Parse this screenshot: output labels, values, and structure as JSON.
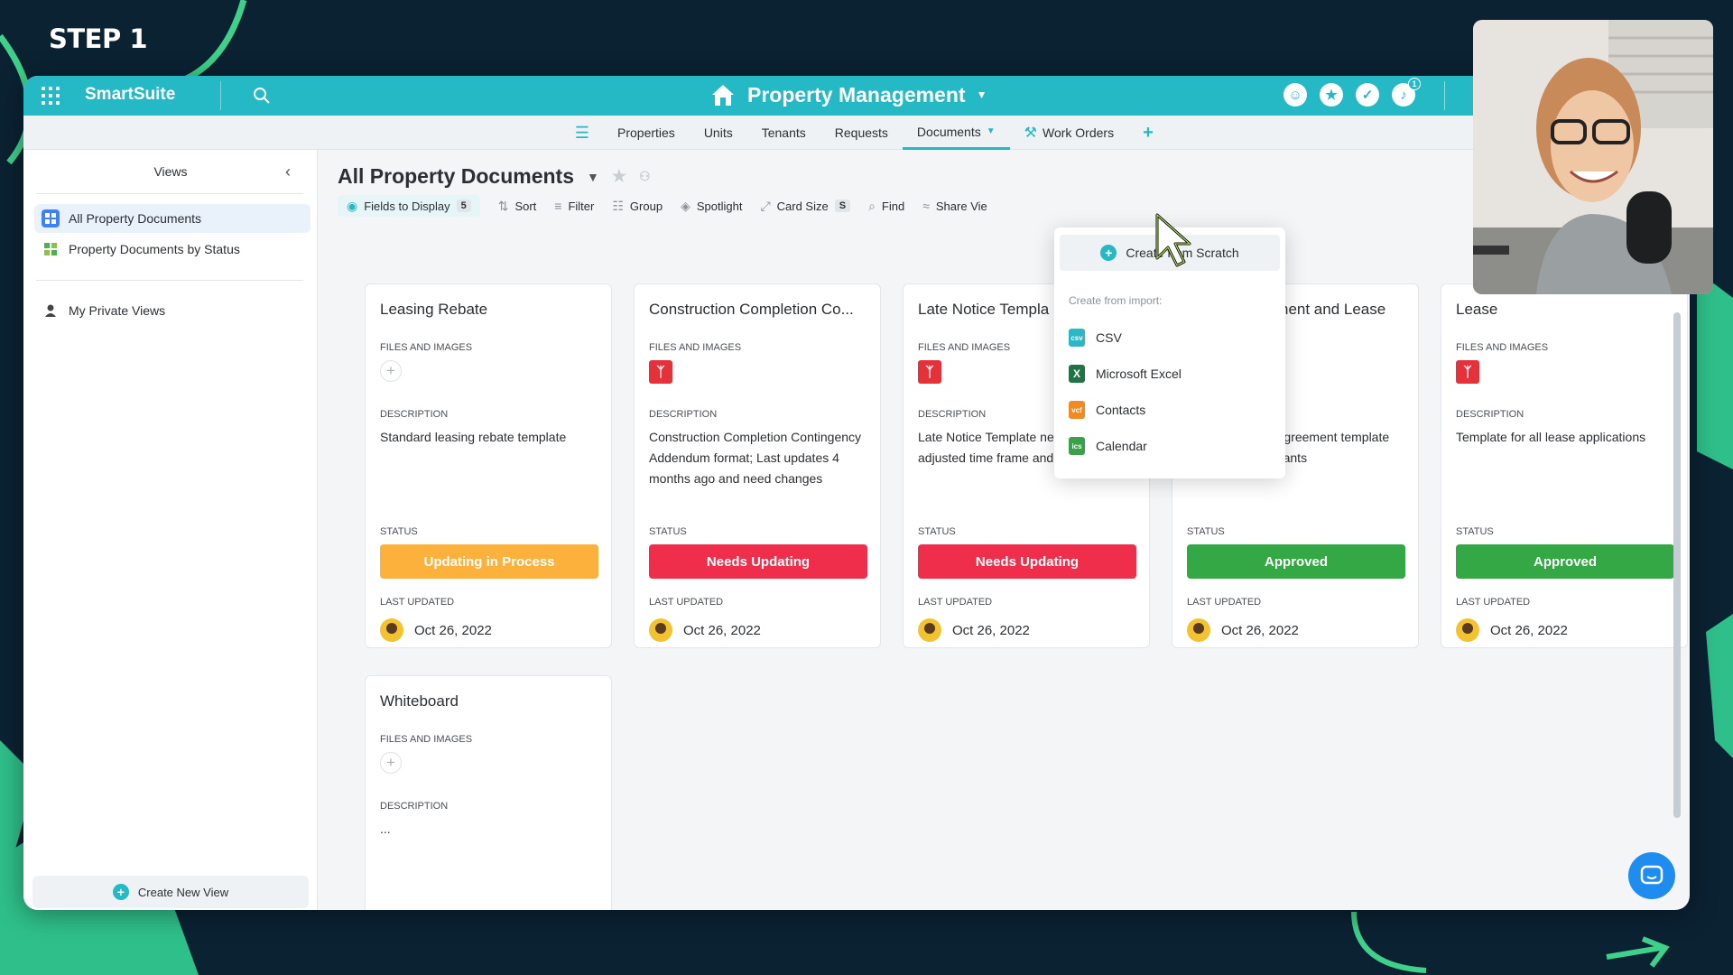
{
  "overlay": {
    "step_label": "STEP 1"
  },
  "app": {
    "brand": "SmartSuite",
    "workspace_title": "Property Management"
  },
  "tabs": [
    {
      "label": "Properties"
    },
    {
      "label": "Units"
    },
    {
      "label": "Tenants"
    },
    {
      "label": "Requests"
    },
    {
      "label": "Documents",
      "active": true
    },
    {
      "label": "Work Orders"
    }
  ],
  "sidebar": {
    "heading": "Views",
    "views": [
      {
        "label": "All Property Documents",
        "selected": true
      },
      {
        "label": "Property Documents by Status"
      }
    ],
    "private_views": "My Private Views",
    "create_view": "Create New View"
  },
  "view": {
    "title": "All Property Documents",
    "toolbar": {
      "fields": "Fields to Display",
      "fields_count": "5",
      "sort": "Sort",
      "filter": "Filter",
      "group": "Group",
      "spotlight": "Spotlight",
      "card_size": "Card Size",
      "card_size_value": "S",
      "find": "Find",
      "share": "Share Vie"
    }
  },
  "labels": {
    "files": "FILES AND IMAGES",
    "description": "DESCRIPTION",
    "status": "STATUS",
    "last_updated": "LAST UPDATED"
  },
  "cards": [
    {
      "title": "Leasing Rebate",
      "has_file": false,
      "description": "Standard leasing rebate template",
      "status": "Updating in Process",
      "status_color": "#fbb13c",
      "updated": "Oct 26, 2022"
    },
    {
      "title": "Construction Completion Co...",
      "has_file": true,
      "description": "Construction Completion Contingency Addendum format; Last updates 4 months ago and need changes",
      "status": "Needs Updating",
      "status_color": "#ee2e4a",
      "updated": "Oct 26, 2022"
    },
    {
      "title": "Late Notice Templa",
      "has_file": true,
      "description": "Late Notice Template needs updating, adjusted time frame and conditions",
      "status": "Needs Updating",
      "status_color": "#ee2e4a",
      "updated": "Oct 26, 2022"
    },
    {
      "title": "Rental Agreement and Lease",
      "has_file": true,
      "description": "Standard rental agreement template for all coming tenants",
      "status": "Approved",
      "status_color": "#33a844",
      "updated": "Oct 26, 2022"
    },
    {
      "title": "Lease",
      "has_file": true,
      "description": "Template for all lease applications",
      "status": "Approved",
      "status_color": "#33a844",
      "updated": "Oct 26, 2022"
    },
    {
      "title": "Whiteboard",
      "has_file": false,
      "description": "...",
      "status": "",
      "status_color": "",
      "updated": ""
    }
  ],
  "dropdown": {
    "create": "Create from Scratch",
    "import_label": "Create from import:",
    "items": [
      {
        "label": "CSV",
        "color": "#2bb8c4",
        "tag": "csv"
      },
      {
        "label": "Microsoft Excel",
        "color": "#217346",
        "tag": "X"
      },
      {
        "label": "Contacts",
        "color": "#f08a24",
        "tag": "vcf"
      },
      {
        "label": "Calendar",
        "color": "#3aa14a",
        "tag": "ics"
      }
    ]
  },
  "colors": {
    "accent": "#25b8c5",
    "background": "#0b2233"
  }
}
